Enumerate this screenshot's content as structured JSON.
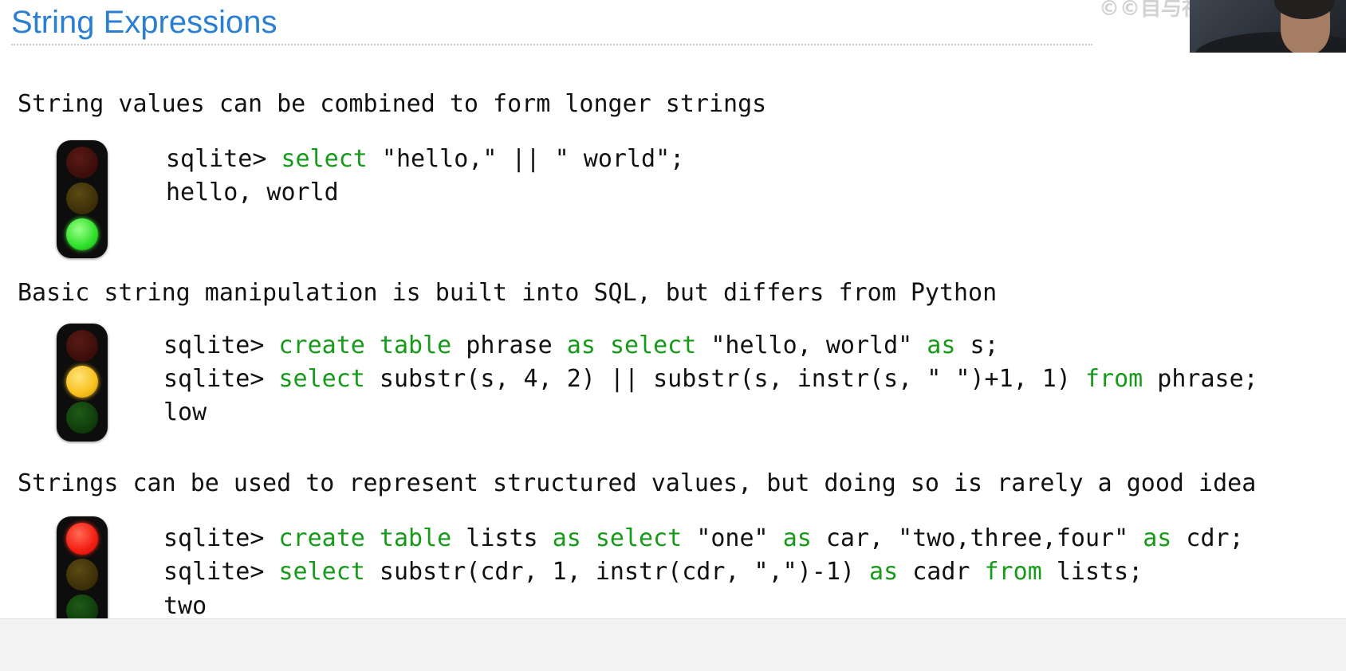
{
  "slide": {
    "title": "String Expressions",
    "watermark": "©©自与社区"
  },
  "sections": [
    {
      "heading": "String values can be combined to form longer strings",
      "light": "green",
      "code": [
        {
          "prompt": "sqlite> ",
          "k1": "select",
          "t1": " \"hello,\" || \" world\";"
        },
        {
          "output": "hello, world"
        }
      ]
    },
    {
      "heading": "Basic string manipulation is built into SQL, but differs from Python",
      "light": "yellow",
      "code": [
        {
          "prompt": "sqlite> ",
          "k1": "create table",
          "t1": " phrase ",
          "k2": "as",
          "t2": " ",
          "k3": "select",
          "t3": " \"hello, world\" ",
          "k4": "as",
          "t4": " s;"
        },
        {
          "prompt": "sqlite> ",
          "k1": "select",
          "t1": " substr(s, 4, 2) || substr(s, instr(s, \" \")+1, 1) ",
          "k2": "from",
          "t2": " phrase;"
        },
        {
          "output": "low"
        }
      ]
    },
    {
      "heading": "Strings can be used to represent structured values, but doing so is rarely a good idea",
      "light": "red",
      "code": [
        {
          "prompt": "sqlite> ",
          "k1": "create table",
          "t1": " lists ",
          "k2": "as",
          "t2": " ",
          "k3": "select",
          "t3": " \"one\" ",
          "k4": "as",
          "t4": " car, \"two,three,four\" ",
          "k5": "as",
          "t5": " cdr;"
        },
        {
          "prompt": "sqlite> ",
          "k1": "select",
          "t1": " substr(cdr, 1, instr(cdr, \",\")-1) ",
          "k2": "as",
          "t2": " cadr ",
          "k3": "from",
          "t3": " lists;"
        },
        {
          "output": "two"
        }
      ]
    }
  ],
  "colors": {
    "title": "#2a7fd0",
    "keyword": "#159a1a",
    "text": "#111111"
  }
}
